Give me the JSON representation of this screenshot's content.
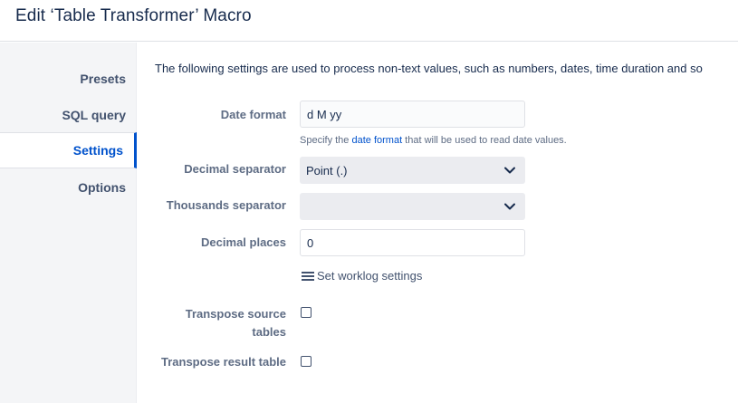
{
  "header": {
    "title": "Edit ‘Table Transformer’ Macro"
  },
  "sidebar": {
    "items": [
      {
        "label": "Presets"
      },
      {
        "label": "SQL query"
      },
      {
        "label": "Settings"
      },
      {
        "label": "Options"
      }
    ],
    "active": "Settings"
  },
  "main": {
    "intro": "The following settings are used to process non-text values, such as numbers, dates, time duration and so",
    "date_format": {
      "label": "Date format",
      "value": "d M yy",
      "hint_prefix": "Specify the ",
      "hint_link": "date format",
      "hint_suffix": " that will be used to read date values."
    },
    "decimal_separator": {
      "label": "Decimal separator",
      "value": "Point (.)"
    },
    "thousands_separator": {
      "label": "Thousands separator",
      "value": ""
    },
    "decimal_places": {
      "label": "Decimal places",
      "value": "0"
    },
    "worklog": {
      "label": "Set worklog settings",
      "icon": "menu-icon"
    },
    "transpose_source": {
      "label_line1": "Transpose source",
      "label_line2": "tables",
      "checked": false
    },
    "transpose_result": {
      "label": "Transpose result table",
      "checked": false
    }
  },
  "colors": {
    "accent": "#0052cc",
    "text": "#172b4d",
    "label": "#5e6c84",
    "sidebar_bg": "#f4f5f7"
  }
}
